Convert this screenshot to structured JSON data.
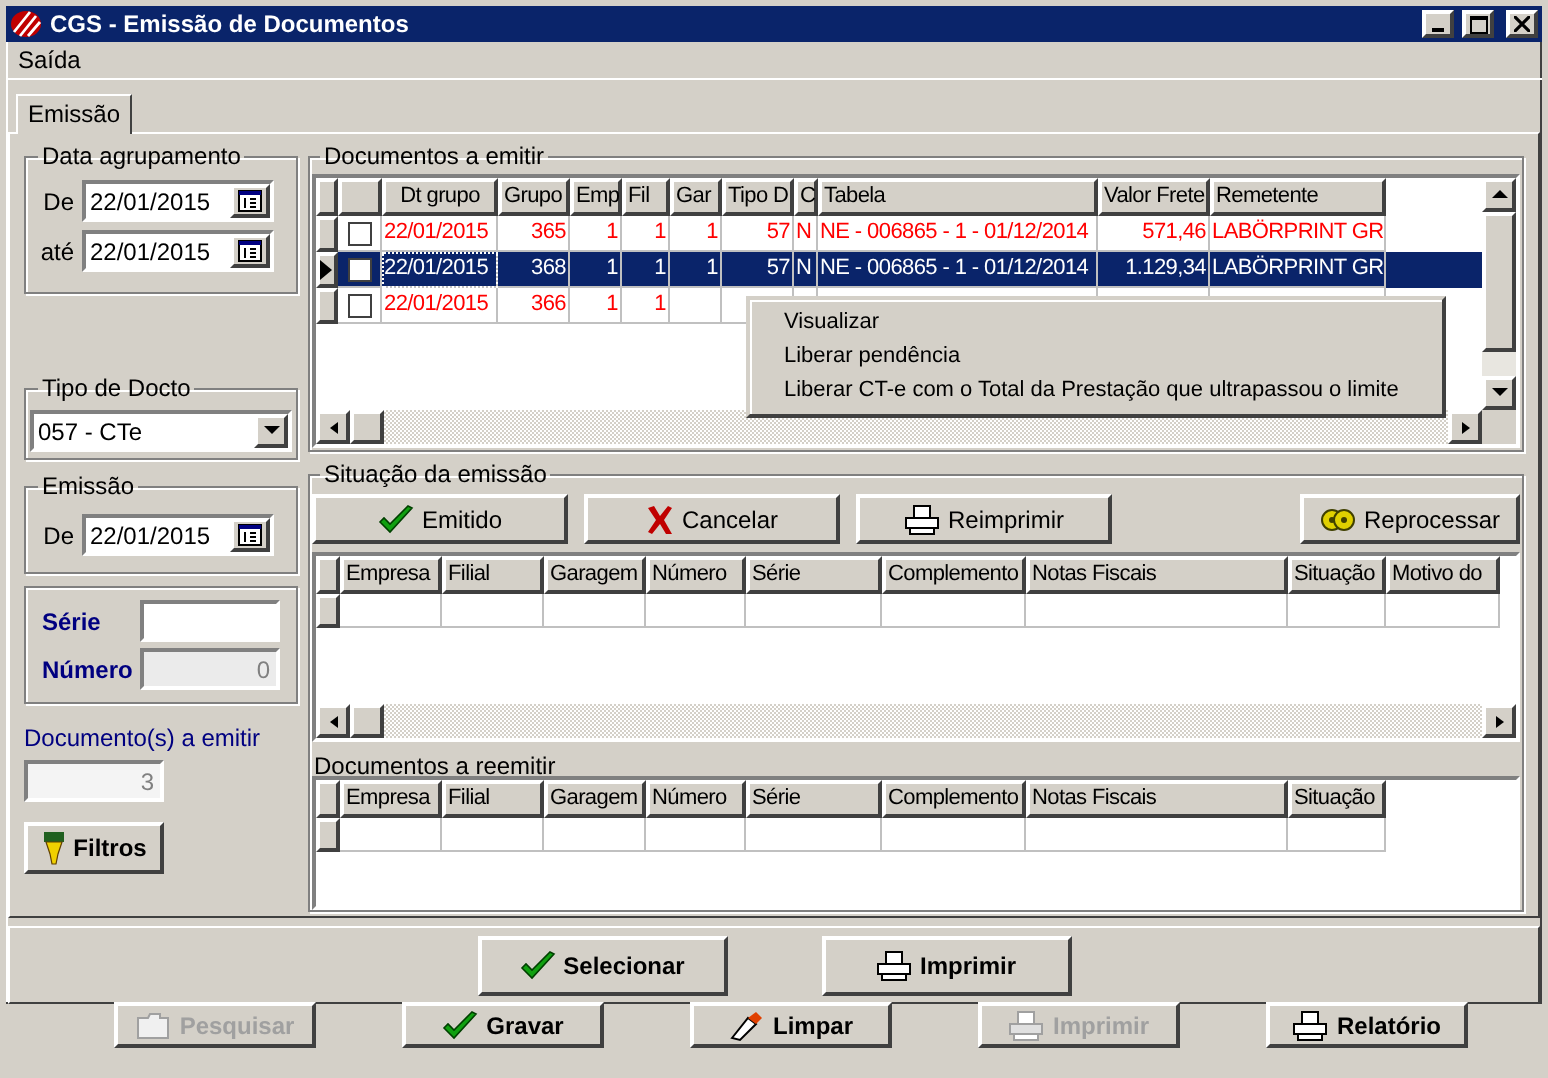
{
  "window": {
    "title": "CGS - Emissão de Documentos"
  },
  "menu": [
    {
      "label": "Saída"
    }
  ],
  "tabs": [
    {
      "label": "Emissão",
      "selected": true
    }
  ],
  "data_agrupamento": {
    "title": "Data agrupamento",
    "fields": [
      {
        "label": "De",
        "value": "22/01/2015"
      },
      {
        "label": "até",
        "value": "22/01/2015"
      }
    ]
  },
  "tipo_docto": {
    "title": "Tipo de Docto",
    "value": "057 - CTe"
  },
  "emissao": {
    "title": "Emissão",
    "fields": [
      {
        "label": "De",
        "value": "22/01/2015"
      }
    ]
  },
  "serie_numero": [
    {
      "label": "Série",
      "disabled": false
    },
    {
      "label": "Número",
      "value": "0",
      "disabled": true
    }
  ],
  "documentos_count": {
    "label": "Documento(s) a emitir",
    "value": "3"
  },
  "filter_button": {
    "label": "Filtros",
    "kind": "filter"
  },
  "documentos_a_emitir": {
    "title": "Documentos a emitir",
    "columns": [
      "Dt grupo",
      "Grupo",
      "Emp",
      "Fil",
      "Gar",
      "Tipo D",
      "C",
      "Tabela",
      "Valor Frete",
      "Remetente"
    ],
    "rows": [
      {
        "selected": false,
        "checked": false,
        "cells": [
          "22/01/2015",
          "365",
          "1",
          "1",
          "1",
          "57",
          "N",
          "NE - 006865 - 1 - 01/12/2014",
          "571,46",
          "LABÖRPRINT GR"
        ]
      },
      {
        "selected": true,
        "checked": false,
        "cells": [
          "22/01/2015",
          "368",
          "1",
          "1",
          "1",
          "57",
          "N",
          "NE - 006865 - 1 - 01/12/2014",
          "1.129,34",
          "LABÖRPRINT GR"
        ]
      },
      {
        "selected": false,
        "checked": false,
        "cells": [
          "22/01/2015",
          "366",
          "1",
          "1",
          null,
          null,
          null,
          null,
          null,
          null
        ]
      }
    ]
  },
  "context_menu": [
    {
      "label": "Visualizar"
    },
    {
      "label": "Liberar pendência"
    },
    {
      "label": "Liberar CT-e com o Total da Prestação que ultrapassou o limite"
    }
  ],
  "situacao": {
    "title": "Situação da emissão",
    "buttons": [
      {
        "label": "Emitido",
        "kind": "check"
      },
      {
        "label": "Cancelar",
        "kind": "x"
      },
      {
        "label": "Reimprimir",
        "kind": "printer"
      },
      {
        "label": "Reprocessar",
        "kind": "gear"
      }
    ],
    "columns": [
      "Empresa",
      "Filial",
      "Garagem",
      "Número",
      "Série",
      "Complemento",
      "Notas Fiscais",
      "Situação",
      "Motivo do"
    ]
  },
  "reemitir": {
    "title": "Documentos a reemitir",
    "columns": [
      "Empresa",
      "Filial",
      "Garagem",
      "Número",
      "Série",
      "Complemento",
      "Notas Fiscais",
      "Situação"
    ]
  },
  "footer_buttons": [
    {
      "label": "Selecionar",
      "kind": "check"
    },
    {
      "label": "Imprimir",
      "kind": "printer"
    }
  ],
  "background_buttons": [
    {
      "label": "Pesquisar",
      "kind": "folder",
      "disabled": true
    },
    {
      "label": "Gravar",
      "kind": "check",
      "disabled": false
    },
    {
      "label": "Limpar",
      "kind": "eraser",
      "disabled": false
    },
    {
      "label": "Imprimir",
      "kind": "printer",
      "disabled": true
    },
    {
      "label": "Relatório",
      "kind": "printer",
      "disabled": false
    }
  ]
}
